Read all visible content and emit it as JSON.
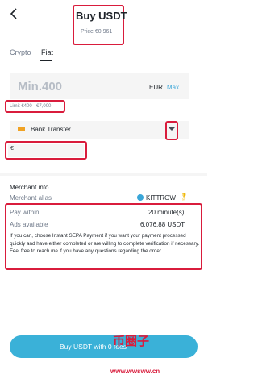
{
  "header": {
    "title": "Buy USDT",
    "price": "Price €0.961"
  },
  "tabs": [
    {
      "label": "Crypto",
      "active": false
    },
    {
      "label": "Fiat",
      "active": true
    }
  ],
  "amount": {
    "value": "Min.400",
    "currency": "EUR",
    "max_label": "Max",
    "limit": "Limit €400 - €7,000"
  },
  "payment": {
    "method": "Bank Transfer",
    "icon": "bank-transfer-icon"
  },
  "secondary_field": {
    "value": "€"
  },
  "merchant": {
    "section_title": "Merchant info",
    "alias_label": "Merchant alias",
    "alias": "KITTROW",
    "badge_icon": "verified-icon",
    "medal_icon": "medal-icon",
    "pay_within_label": "Pay within",
    "pay_within": "20 minute(s)",
    "ads_label": "Ads available",
    "ads_available": "6,076.88 USDT",
    "terms": "If you can, choose Instant SEPA Payment if you want your payment processed quickly and have either completed or are willing to complete verification if necessary. Feel free to reach me if you have any questions regarding the order"
  },
  "buy_button": {
    "label": "Buy USDT with 0 fees"
  },
  "watermark": {
    "logo": "币圈子",
    "url": "www.wwsww.cn"
  },
  "colors": {
    "accent": "#3ab1d8",
    "highlight": "#d91c3c",
    "field_bg": "#f5f5f5",
    "muted_text": "#707a8a"
  }
}
